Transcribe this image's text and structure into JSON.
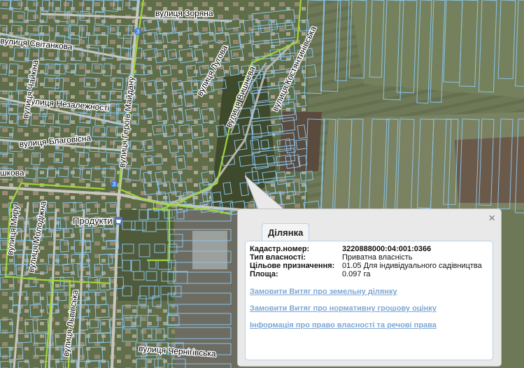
{
  "map": {
    "streets": [
      {
        "id": "zoriana",
        "text": "вулиця Зоряна"
      },
      {
        "id": "svitankova",
        "text": "вулиця Світанкова"
      },
      {
        "id": "nezalezhnosti",
        "text": "вулиця Незалежності"
      },
      {
        "id": "blahovisna",
        "text": "вулиця Благовісна"
      },
      {
        "id": "shkova",
        "text": "шкова"
      },
      {
        "id": "chaikina",
        "text": "вулиця Чайкіна"
      },
      {
        "id": "heroiv_maidanu",
        "text": "вулиця Героїв Майдану"
      },
      {
        "id": "lukova",
        "text": "вулиця Лугова"
      },
      {
        "id": "vyshneva",
        "text": "вулиця Вишнева"
      },
      {
        "id": "kostiantynivska",
        "text": "вулиця Костянтинівська"
      },
      {
        "id": "myru",
        "text": "вулиця Миру"
      },
      {
        "id": "molodizhna",
        "text": "вулиця Молодіжна"
      },
      {
        "id": "lvivska",
        "text": "вулиця Львівська"
      },
      {
        "id": "chernihivska",
        "text": "вулиця Чернігівська"
      }
    ],
    "poi": {
      "label": "Продукти"
    },
    "route_markers": [
      "3",
      "3"
    ]
  },
  "popup": {
    "tab_label": "Ділянка",
    "close_symbol": "×",
    "fields": [
      {
        "label": "Кадастр.номер:",
        "value": "3220888000:04:001:0366",
        "bold": true
      },
      {
        "label": "Тип власності:",
        "value": "Приватна власність",
        "bold": false
      },
      {
        "label": "Цільове призначення:",
        "value": "01.05 Для індивідуального садівництва",
        "bold": false
      },
      {
        "label": "Площа:",
        "value": "0.097 га",
        "bold": false
      }
    ],
    "links": [
      "Замовити Витяг про земельну ділянку",
      "Замовити Витяг про нормативну грошову оцінку",
      "Інформація про право власності та речові права"
    ]
  },
  "colors": {
    "parcel_outline": "#8cc8f0",
    "boundary_line": "#9fd63a",
    "link": "#7ea7d6",
    "panel_border": "#b8d2ea"
  }
}
